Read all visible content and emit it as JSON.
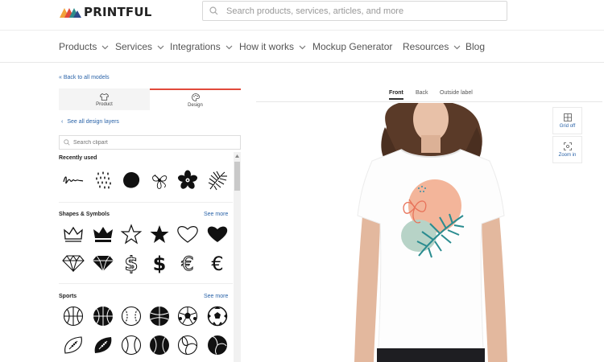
{
  "brand": {
    "name": "PRINTFUL",
    "colors": [
      "#e14a3b",
      "#f2a23a",
      "#2e8b8b",
      "#2c4a8a"
    ]
  },
  "search": {
    "placeholder": "Search products, services, articles, and more"
  },
  "nav": {
    "items": [
      {
        "label": "Products",
        "has_dropdown": true
      },
      {
        "label": "Services",
        "has_dropdown": true
      },
      {
        "label": "Integrations",
        "has_dropdown": true
      },
      {
        "label": "How it works",
        "has_dropdown": true
      },
      {
        "label": "Mockup Generator",
        "has_dropdown": false
      },
      {
        "label": "Resources",
        "has_dropdown": true
      },
      {
        "label": "Blog",
        "has_dropdown": false
      }
    ]
  },
  "editor": {
    "back_link": "« Back to all models",
    "tabs": [
      {
        "label": "Product",
        "icon": "tshirt-icon"
      },
      {
        "label": "Design",
        "icon": "palette-icon",
        "active": true
      }
    ],
    "see_layers": "See all design layers",
    "clipart_search_placeholder": "Search clipart",
    "sections": [
      {
        "title": "Recently used",
        "see_more": "",
        "icons": [
          "scribble-icon",
          "dots-icon",
          "blob-icon",
          "hibiscus-icon",
          "flower-icon",
          "palm-leaf-icon"
        ]
      },
      {
        "title": "Shapes & Symbols",
        "see_more": "See more",
        "icons": [
          "crown-outline-icon",
          "crown-icon",
          "star-outline-icon",
          "star-icon",
          "heart-outline-icon",
          "heart-icon",
          "diamond-outline-icon",
          "diamond-icon",
          "dollar-outline-icon",
          "dollar-icon",
          "euro-outline-icon",
          "euro-icon"
        ]
      },
      {
        "title": "Sports",
        "see_more": "See more",
        "icons": [
          "basketball-outline-icon",
          "basketball-icon",
          "baseball-outline-icon",
          "basketball-solid-icon",
          "soccer-ball-outline-icon",
          "soccer-ball-icon",
          "football-outline-icon",
          "football-icon",
          "baseball-icon",
          "tennis-ball-icon",
          "volleyball-icon",
          "volleyball-solid-icon"
        ]
      }
    ]
  },
  "preview": {
    "tabs": [
      {
        "label": "Front",
        "active": true
      },
      {
        "label": "Back"
      },
      {
        "label": "Outside label"
      }
    ],
    "buttons": [
      {
        "label": "Grid off",
        "icon": "grid-icon"
      },
      {
        "label": "Zoom in",
        "icon": "zoom-icon"
      }
    ],
    "accent": "#e14a3b"
  }
}
